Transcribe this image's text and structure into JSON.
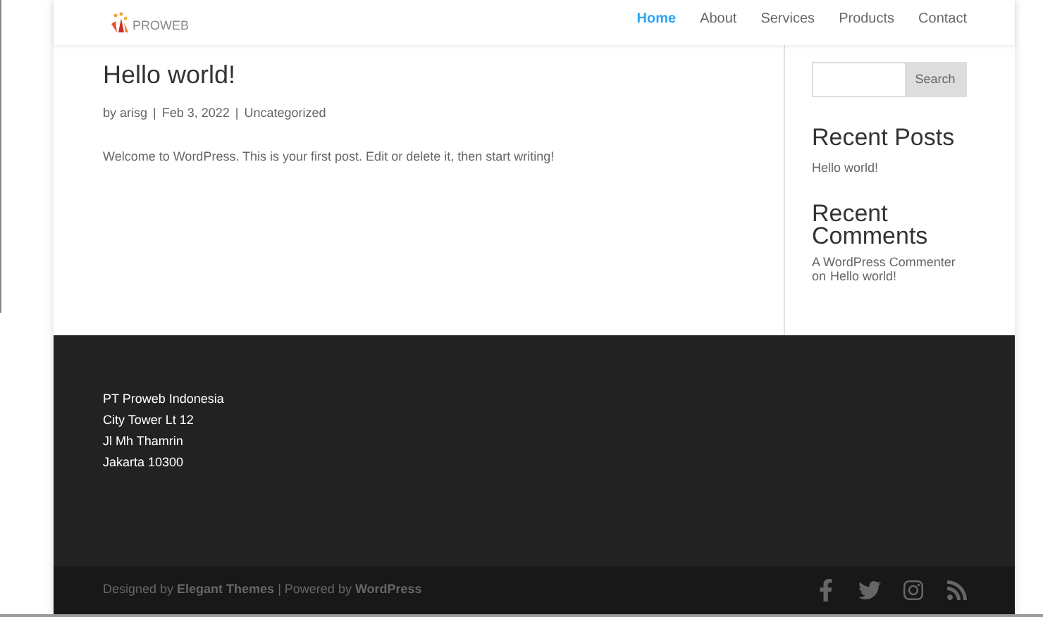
{
  "header": {
    "logo_text": "PROWEB",
    "nav": [
      {
        "label": "Home",
        "selected": true
      },
      {
        "label": "About",
        "selected": false
      },
      {
        "label": "Services",
        "selected": false
      },
      {
        "label": "Products",
        "selected": false
      },
      {
        "label": "Contact",
        "selected": false
      }
    ]
  },
  "post": {
    "title": "Hello world!",
    "meta": {
      "author": "by arisg",
      "separators": [
        "|",
        "|"
      ],
      "date": "Feb 3, 2022",
      "category": "Uncategorized"
    },
    "body": "Welcome to WordPress. This is your first post. Edit or delete it, then start writing!"
  },
  "sidebar": {
    "search_button": "Search",
    "recent_posts": {
      "title": "Recent Posts",
      "items": [
        "Hello world!"
      ]
    },
    "recent_comments": {
      "title": "Recent Comments",
      "items": [
        {
          "author": "A WordPress Commenter",
          "on": "on",
          "post": "Hello world!"
        }
      ]
    }
  },
  "footer": {
    "address": [
      "PT Proweb Indonesia",
      "City Tower Lt 12",
      "Jl Mh Thamrin",
      "Jakarta 10300"
    ],
    "credits": "Designed by **Elegant Themes** | Powered by **WordPress**",
    "social": [
      {
        "kind": "facebook"
      },
      {
        "kind": "twitter"
      },
      {
        "kind": "instagram"
      },
      {
        "kind": "rss"
      }
    ]
  }
}
